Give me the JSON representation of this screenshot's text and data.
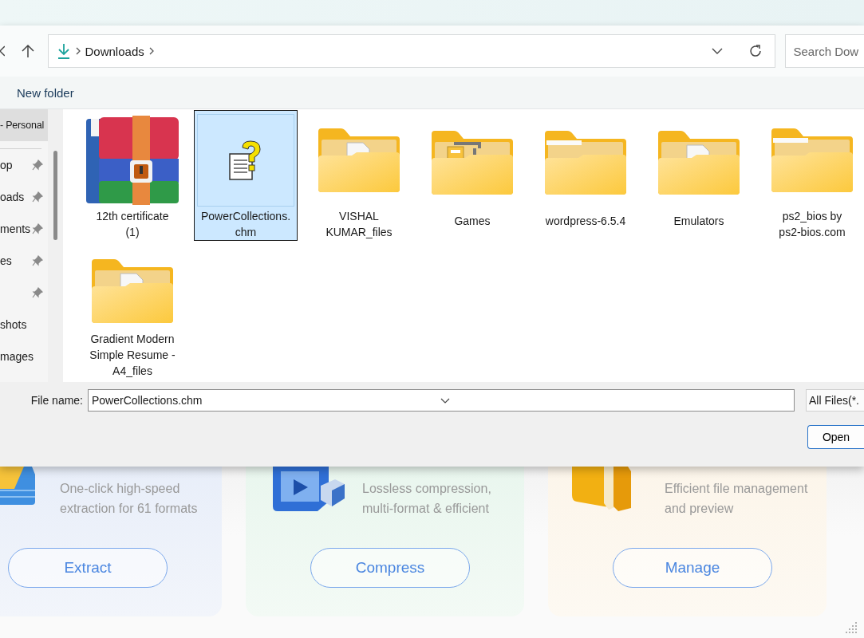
{
  "address_bar": {
    "location": "Downloads",
    "search_placeholder": "Search Dow"
  },
  "command_bar": {
    "new_folder": "New folder"
  },
  "sidebar": {
    "items": [
      {
        "label": "- Personal",
        "pinned": false,
        "selected": true
      },
      {
        "label": "op",
        "pinned": true,
        "selected": false
      },
      {
        "label": "oads",
        "pinned": true,
        "selected": false
      },
      {
        "label": "ments",
        "pinned": true,
        "selected": false
      },
      {
        "label": "es",
        "pinned": true,
        "selected": false
      },
      {
        "pinned": true,
        "selected": false
      },
      {
        "label": "shots",
        "pinned": false,
        "selected": false
      },
      {
        "label": "mages",
        "pinned": false,
        "selected": false
      }
    ]
  },
  "files": [
    {
      "name": "12th certificate\n(1)",
      "kind": "archive",
      "selected": false
    },
    {
      "name": "PowerCollections.\nchm",
      "kind": "help",
      "selected": true
    },
    {
      "name": "VISHAL\nKUMAR_files",
      "kind": "docfolder",
      "selected": false
    },
    {
      "name": "Games",
      "kind": "cabinetfolder",
      "selected": false
    },
    {
      "name": "wordpress-6.5.4",
      "kind": "folder",
      "selected": false
    },
    {
      "name": "Emulators",
      "kind": "docfolder",
      "selected": false
    },
    {
      "name": "ps2_bios by\nps2-bios.com",
      "kind": "folder",
      "selected": false
    },
    {
      "name": "Gradient Modern\nSimple Resume -\nA4_files",
      "kind": "docfolder",
      "selected": false
    }
  ],
  "footer": {
    "file_name_label": "File name:",
    "file_name": "PowerCollections.chm",
    "file_type": "All Files(*.",
    "open_button": "Open"
  },
  "cards": [
    {
      "kind": "extract",
      "description": "One-click high-speed\nextraction for 61 formats",
      "button": "Extract"
    },
    {
      "kind": "compress",
      "description": "Lossless compression,\nmulti-format & efficient",
      "button": "Compress"
    },
    {
      "kind": "manage",
      "description": "Efficient file management\nand preview",
      "button": "Manage"
    }
  ]
}
